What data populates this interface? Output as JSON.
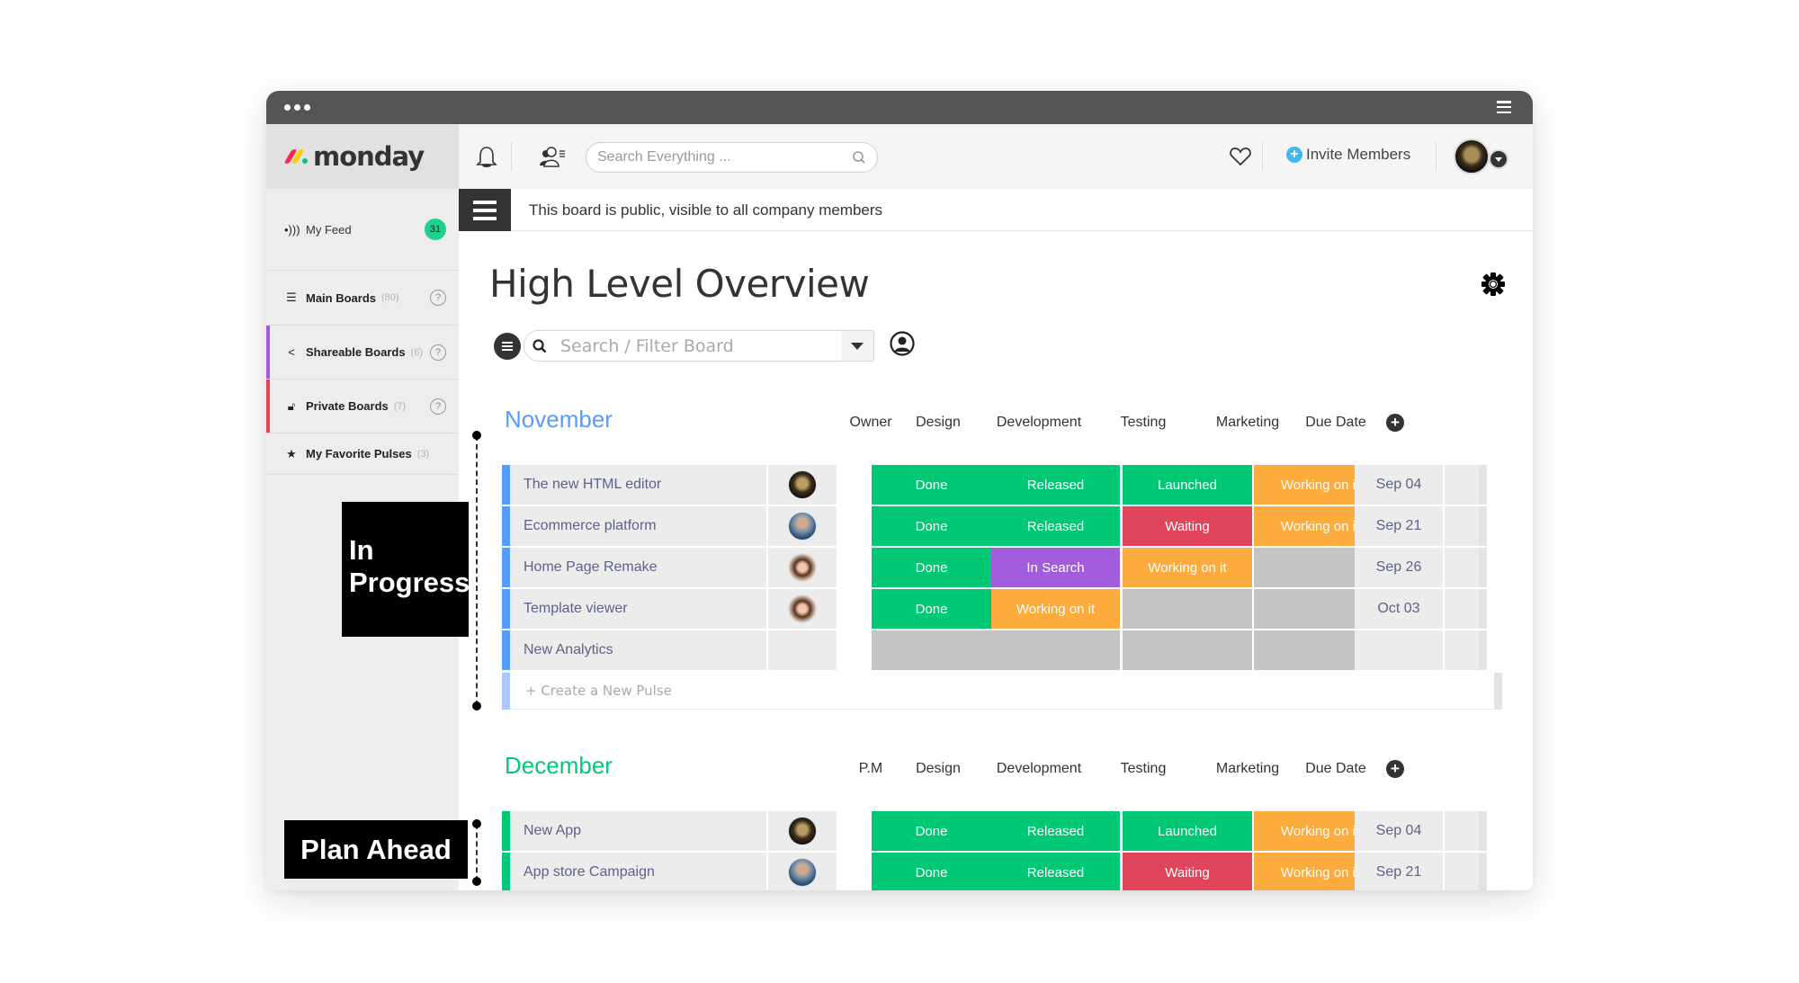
{
  "window": {
    "menu_icon": "hamburger-icon"
  },
  "sidebar": {
    "logo_text": "monday",
    "logo_colors": [
      "#f62b54",
      "#ffcc00",
      "#00ca72"
    ],
    "items": [
      {
        "label": "My Feed",
        "icon": "feed-icon",
        "badge": "31"
      },
      {
        "label": "Main Boards",
        "icon": "list-icon",
        "count": "(80)",
        "help": "?"
      },
      {
        "label": "Shareable Boards",
        "icon": "share-icon",
        "count": "(6)",
        "help": "?",
        "accent": "#a25ddc"
      },
      {
        "label": "Private Boards",
        "icon": "lock-icon",
        "count": "(7)",
        "help": "?",
        "accent": "#e2445c"
      },
      {
        "label": "My Favorite Pulses",
        "icon": "star-icon",
        "count": "(3)"
      }
    ]
  },
  "topbar": {
    "search_placeholder": "Search Everything ...",
    "invite_label": "Invite Members"
  },
  "notice": {
    "text": "This board is public, visible to all company members"
  },
  "board": {
    "title": "High Level Overview",
    "filter_placeholder": "Search / Filter Board",
    "create_pulse_label": "+ Create a New Pulse"
  },
  "status_colors": {
    "Done": "#00c875",
    "Released": "#00c875",
    "Launched": "#00c875",
    "Waiting": "#e2445c",
    "Working on it": "#fdab3d",
    "In Search": "#a25ddc",
    "": "#c4c4c4"
  },
  "groups": [
    {
      "title": "November",
      "color": "#579bfc",
      "columns": [
        "Owner",
        "Design",
        "Development",
        "Testing",
        "Marketing",
        "Due Date"
      ],
      "rows": [
        {
          "name": "The new HTML editor",
          "owner": "av-a",
          "design": "Done",
          "development": "Released",
          "testing": "Launched",
          "marketing": "Working on it",
          "due": "Sep 04"
        },
        {
          "name": "Ecommerce platform",
          "owner": "av-b",
          "design": "Done",
          "development": "Released",
          "testing": "Waiting",
          "marketing": "Working on it",
          "due": "Sep 21"
        },
        {
          "name": "Home Page Remake",
          "owner": "av-c",
          "design": "Done",
          "development": "In Search",
          "testing": "Working on it",
          "marketing": "",
          "due": "Sep 26"
        },
        {
          "name": "Template viewer",
          "owner": "av-c",
          "design": "Done",
          "development": "Working on it",
          "testing": "",
          "marketing": "",
          "due": "Oct 03"
        },
        {
          "name": "New Analytics",
          "owner": "",
          "design": "",
          "development": "",
          "testing": "",
          "marketing": "",
          "due": ""
        }
      ]
    },
    {
      "title": "December",
      "color": "#00c875",
      "columns": [
        "P.M",
        "Design",
        "Development",
        "Testing",
        "Marketing",
        "Due Date"
      ],
      "rows": [
        {
          "name": "New App",
          "owner": "av-a",
          "design": "Done",
          "development": "Released",
          "testing": "Launched",
          "marketing": "Working on it",
          "due": "Sep 04"
        },
        {
          "name": "App store Campaign",
          "owner": "av-b",
          "design": "Done",
          "development": "Released",
          "testing": "Waiting",
          "marketing": "Working on it",
          "due": "Sep 21"
        }
      ]
    }
  ],
  "annotations": {
    "in_progress": "In Progress",
    "plan_ahead": "Plan Ahead"
  }
}
